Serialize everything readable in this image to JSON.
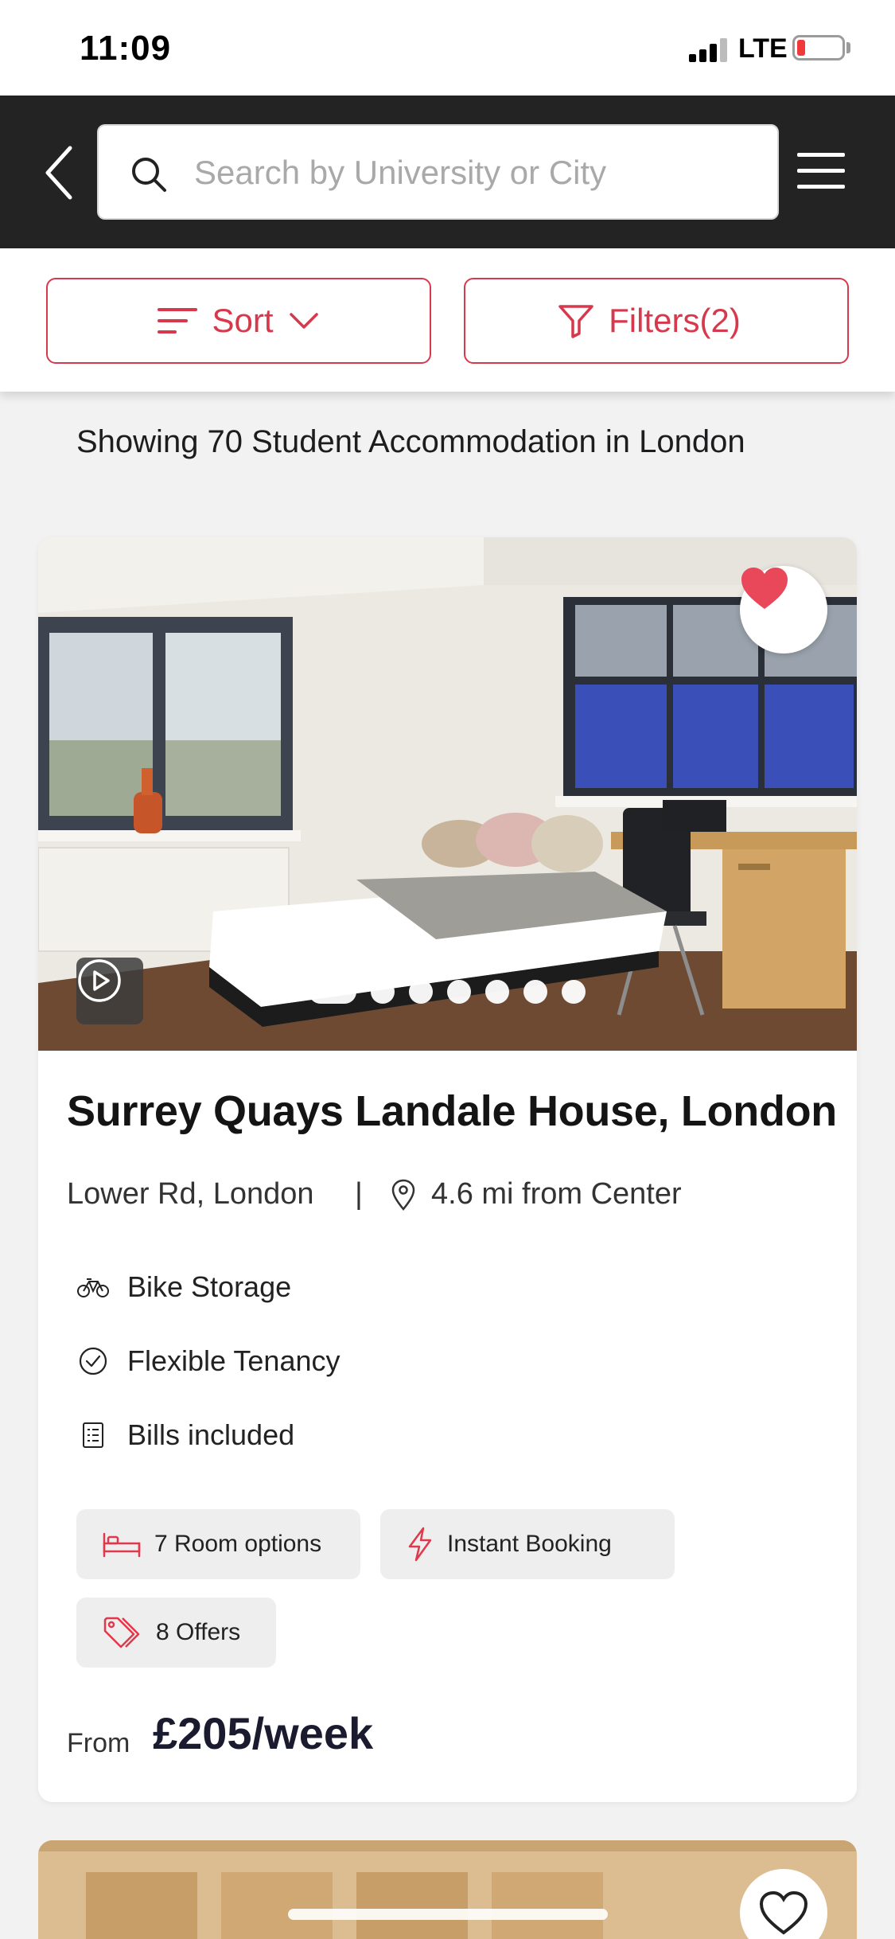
{
  "status_bar": {
    "time": "11:09",
    "network": "LTE",
    "battery_color": "#f03a3a"
  },
  "header": {
    "search_placeholder": "Search by University or City",
    "background": "#232323"
  },
  "toolbar": {
    "sort_label": "Sort",
    "filters_label": "Filters(2)",
    "accent": "#d6394b"
  },
  "results": {
    "text": "Showing 70 Student Accommodation in London"
  },
  "listing": {
    "title": "Surrey Quays Landale House, London",
    "address": "Lower Rd, London",
    "separator": "|",
    "distance": "4.6 mi from Center",
    "favorited": true,
    "photo_count": 7,
    "active_photo": 1,
    "features": [
      {
        "icon": "bike-icon",
        "label": "Bike Storage"
      },
      {
        "icon": "check-circle-icon",
        "label": "Flexible Tenancy"
      },
      {
        "icon": "bill-icon",
        "label": "Bills included"
      }
    ],
    "chips": [
      {
        "icon": "bed-icon",
        "label": "7 Room options"
      },
      {
        "icon": "lightning-icon",
        "label": "Instant Booking"
      },
      {
        "icon": "tag-icon",
        "label": "8 Offers"
      }
    ],
    "price_prefix": "From",
    "price": "£205/week"
  },
  "next_listing": {
    "favorited": false
  }
}
